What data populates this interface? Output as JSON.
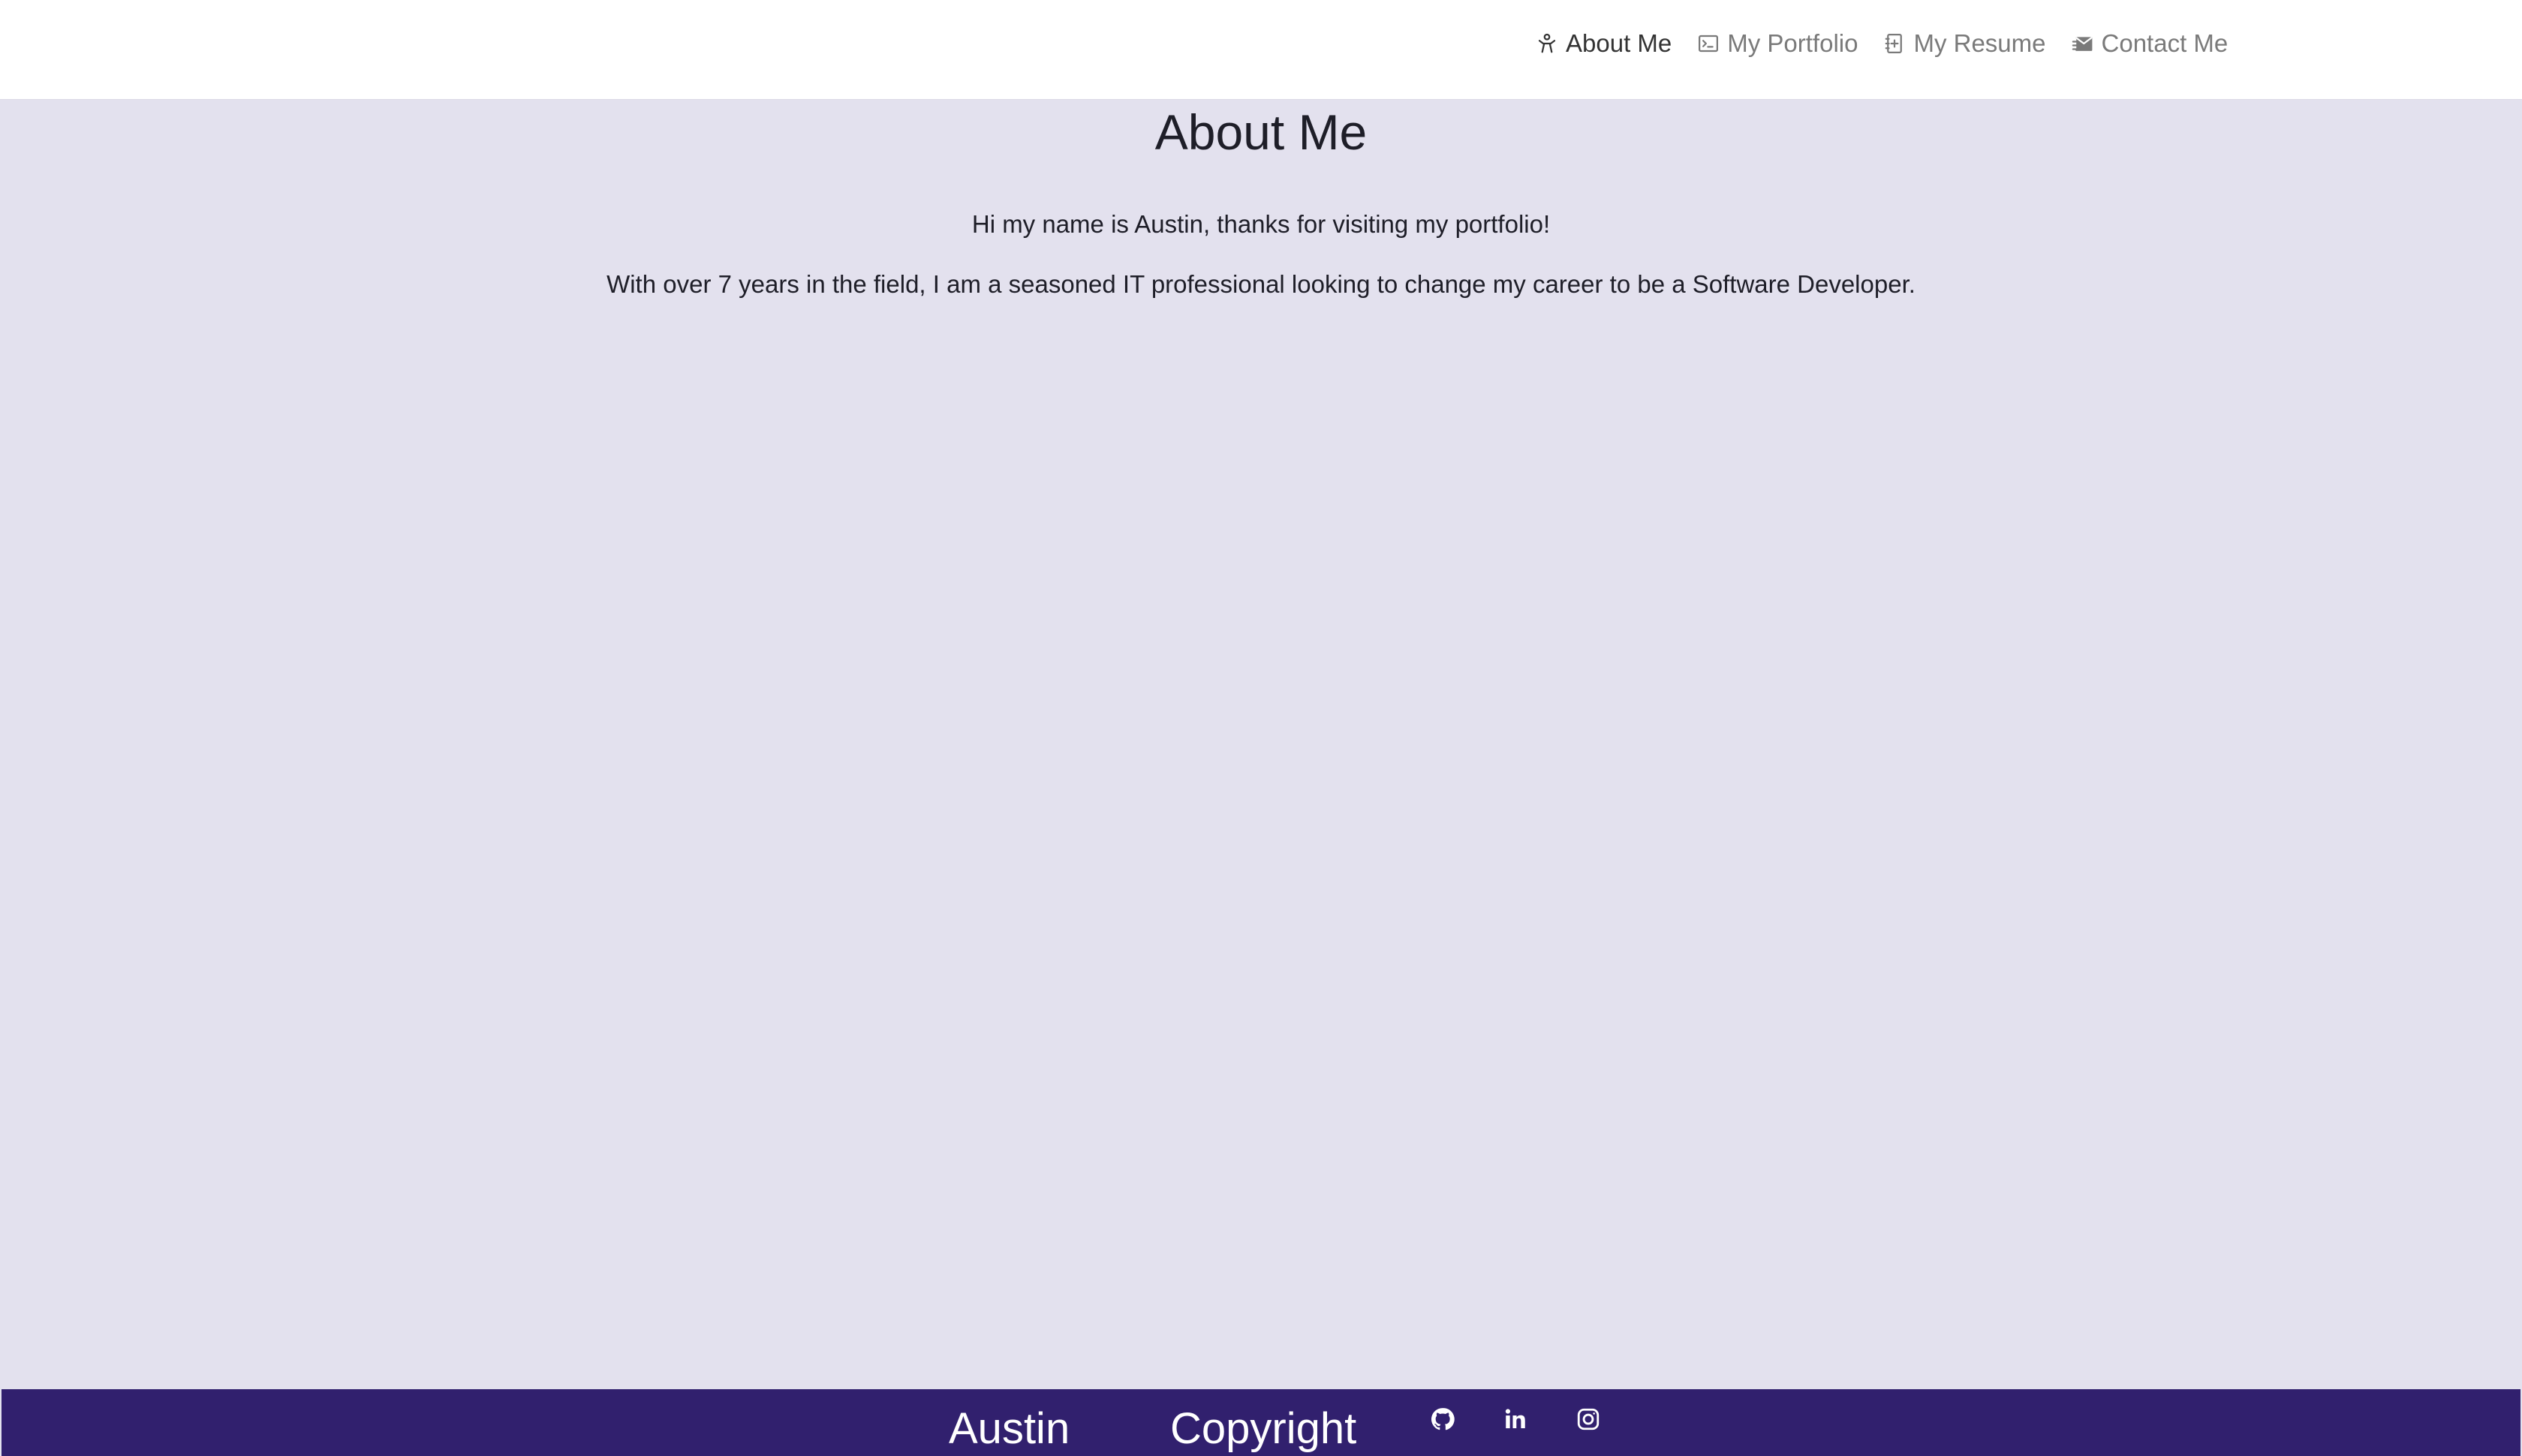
{
  "nav": {
    "items": [
      {
        "label": "About Me",
        "icon": "person-icon",
        "active": true
      },
      {
        "label": "My Portfolio",
        "icon": "terminal-icon",
        "active": false
      },
      {
        "label": "My Resume",
        "icon": "document-icon",
        "active": false
      },
      {
        "label": "Contact Me",
        "icon": "mail-icon",
        "active": false
      }
    ]
  },
  "main": {
    "title": "About Me",
    "paragraphs": [
      "Hi my name is Austin, thanks for visiting my portfolio!",
      "With over 7 years in the field, I am a seasoned IT professional looking to change my career to be a Software Developer."
    ]
  },
  "footer": {
    "name": "Austin",
    "copyright": "Copyright",
    "social": [
      {
        "icon": "github-icon"
      },
      {
        "icon": "linkedin-icon"
      },
      {
        "icon": "instagram-icon"
      }
    ]
  },
  "colors": {
    "nav_background": "#ffffff",
    "page_background": "#e3e1ee",
    "footer_background": "#31206e",
    "text_dark": "#1e1e28",
    "nav_inactive": "#7a7a7a",
    "nav_active": "#333333"
  }
}
